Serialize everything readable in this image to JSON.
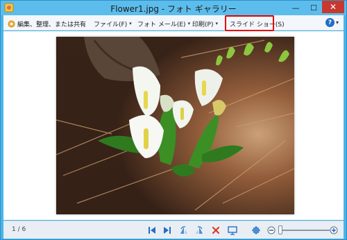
{
  "window": {
    "title": "Flower1.jpg - フォト ギャラリー",
    "minimize_glyph": "—",
    "maximize_glyph": "☐",
    "close_glyph": "✕"
  },
  "menubar": {
    "organize_label": "編集、整理、または共有",
    "file_label": "ファイル(F)",
    "email_label": "フォト メール(E)",
    "print_label": "印刷(P)",
    "slideshow_label": "スライド ショー(S)",
    "help_icon": "help-icon",
    "caret": "▾"
  },
  "status": {
    "counter": "1 / 6"
  },
  "colors": {
    "frame": "#4bb4e6",
    "highlight": "#e30000",
    "close_button": "#c7392f",
    "accent_blue": "#1f6fc5"
  }
}
